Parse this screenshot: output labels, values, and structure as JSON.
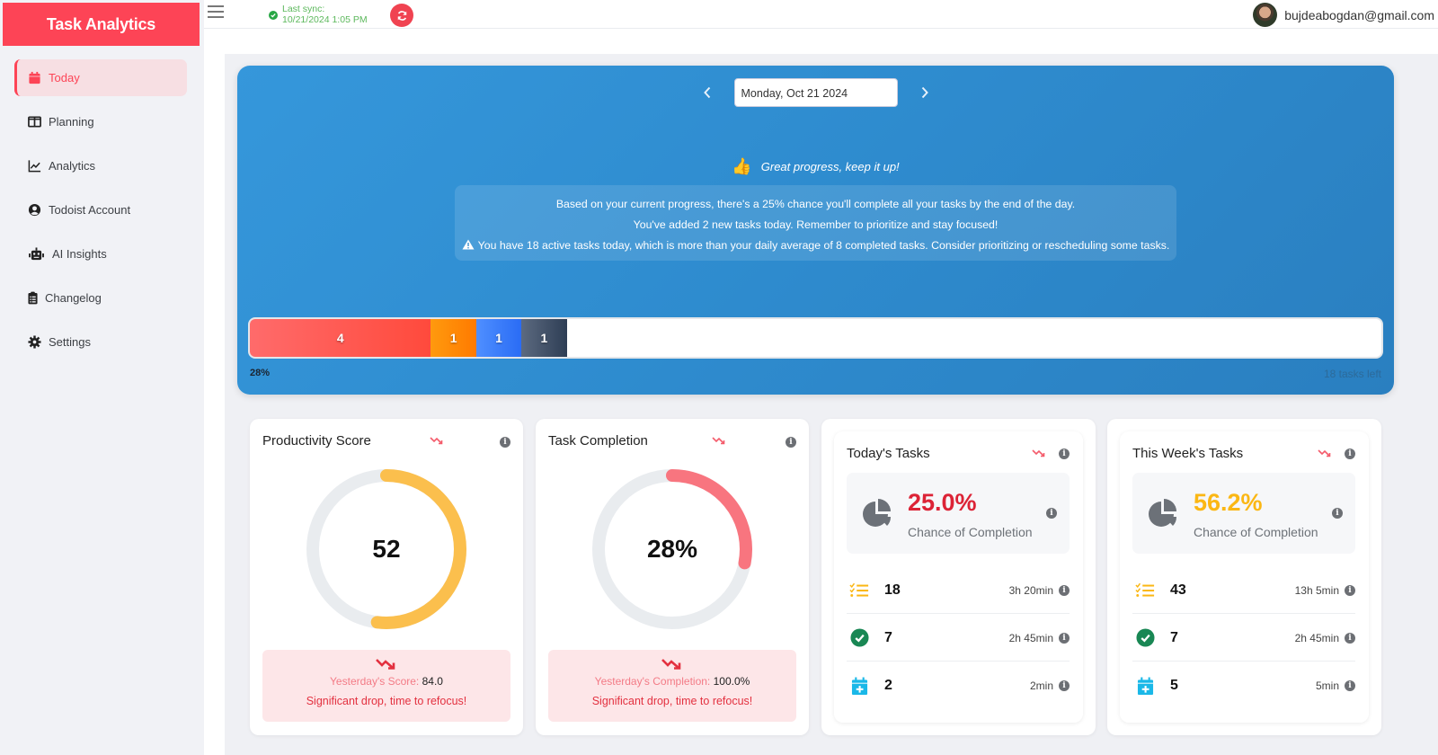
{
  "app": {
    "title": "Task Analytics"
  },
  "sidebar": {
    "items": [
      {
        "label": "Today",
        "icon": "calendar-icon",
        "active": true
      },
      {
        "label": "Planning",
        "icon": "columns-icon",
        "active": false
      },
      {
        "label": "Analytics",
        "icon": "line-chart-icon",
        "active": false
      },
      {
        "label": "Todoist Account",
        "icon": "user-circle-icon",
        "active": false
      },
      {
        "label": "AI Insights",
        "icon": "robot-icon",
        "active": false
      },
      {
        "label": "Changelog",
        "icon": "clipboard-list-icon",
        "active": false
      },
      {
        "label": "Settings",
        "icon": "gear-icon",
        "active": false
      }
    ]
  },
  "topbar": {
    "sync_label": "Last sync:",
    "sync_time": "10/21/2024 1:05 PM",
    "user_email": "bujdeabogdan@gmail.com"
  },
  "hero": {
    "date_value": "Monday, Oct 21 2024",
    "motivation": "Great progress, keep it up!",
    "insights": [
      "Based on your current progress, there's a 25% chance you'll complete all your tasks by the end of the day.",
      "You've added 2 new tasks today. Remember to prioritize and stay focused!",
      "You have 18 active tasks today, which is more than your daily average of 8 completed tasks. Consider prioritizing or rescheduling some tasks."
    ],
    "progress": {
      "segments": [
        {
          "value": 4,
          "label": "4",
          "color_from": "#ff6b6b",
          "color_to": "#ff4a3c"
        },
        {
          "value": 1,
          "label": "1",
          "color_from": "#ff9a0e",
          "color_to": "#ff7a00"
        },
        {
          "value": 1,
          "label": "1",
          "color_from": "#4f8fff",
          "color_to": "#2a6cf5"
        },
        {
          "value": 1,
          "label": "1",
          "color_from": "#5c6a80",
          "color_to": "#2e3e55"
        }
      ],
      "total": 25,
      "percent_label": "28%",
      "remaining_label": "18 tasks left"
    }
  },
  "productivity": {
    "title": "Productivity Score",
    "value": 52,
    "value_label": "52",
    "max": 100,
    "color": "#fbbf4d",
    "prev_label": "Yesterday's Score:",
    "prev_value": "84.0",
    "message": "Significant drop, time to refocus!"
  },
  "completion": {
    "title": "Task Completion",
    "value": 28,
    "value_label": "28%",
    "max": 100,
    "color": "#f8757f",
    "prev_label": "Yesterday's Completion:",
    "prev_value": "100.0%",
    "message": "Significant drop, time to refocus!"
  },
  "today_tasks": {
    "title": "Today's Tasks",
    "chance": "25.0%",
    "chance_color": "#dc2336",
    "chance_label": "Chance of Completion",
    "rows": [
      {
        "icon": "task-list-icon",
        "count": "18",
        "duration": "3h 20min"
      },
      {
        "icon": "check-circle-icon",
        "count": "7",
        "duration": "2h 45min"
      },
      {
        "icon": "calendar-plus-icon",
        "count": "2",
        "duration": "2min"
      }
    ]
  },
  "week_tasks": {
    "title": "This Week's Tasks",
    "chance": "56.2%",
    "chance_color": "#fbb714",
    "chance_label": "Chance of Completion",
    "rows": [
      {
        "icon": "task-list-icon",
        "count": "43",
        "duration": "13h 5min"
      },
      {
        "icon": "check-circle-icon",
        "count": "7",
        "duration": "2h 45min"
      },
      {
        "icon": "calendar-plus-icon",
        "count": "5",
        "duration": "5min"
      }
    ]
  }
}
